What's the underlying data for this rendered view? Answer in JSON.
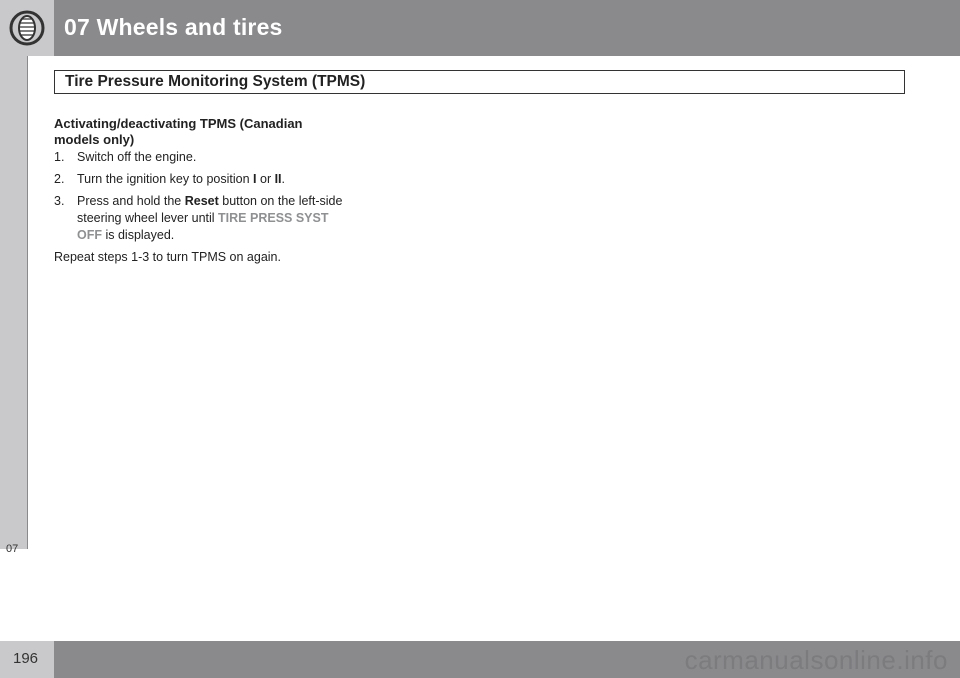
{
  "header": {
    "chapter_title": "07 Wheels and tires",
    "icon": "tire-icon"
  },
  "section": {
    "title": "Tire Pressure Monitoring System (TPMS)"
  },
  "side_tab": {
    "label": "07"
  },
  "content": {
    "subheading": "Activating/deactivating TPMS (Canadian models only)",
    "steps": [
      {
        "number": "1.",
        "text": "Switch off the engine."
      },
      {
        "number": "2.",
        "text_before": "Turn the ignition key to position ",
        "position_1": "I",
        "text_or": " or ",
        "position_2": "II",
        "text_after": "."
      },
      {
        "number": "3.",
        "text_before": "Press and hold the ",
        "button_name": "Reset",
        "text_middle": " button on the left-side steering wheel lever until ",
        "display_message": "TIRE PRESS SYST OFF",
        "text_after": " is displayed."
      }
    ],
    "repeat_text": "Repeat steps 1-3 to turn TPMS on again."
  },
  "footer": {
    "page_number": "196",
    "watermark": "carmanualsonline.info"
  }
}
